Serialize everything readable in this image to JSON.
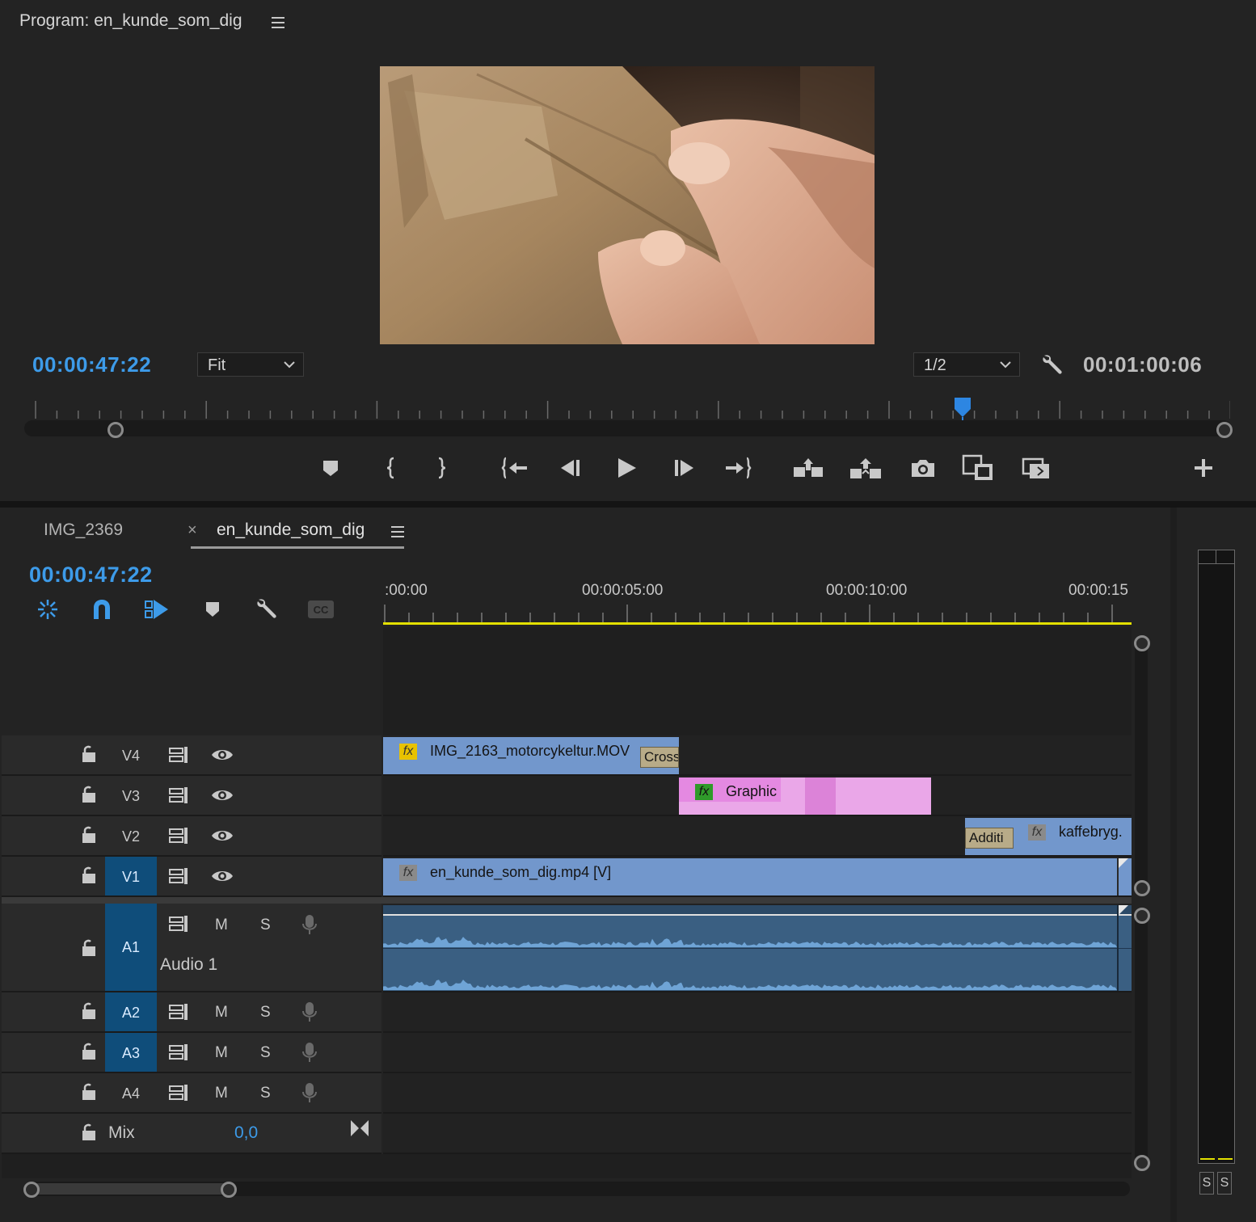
{
  "program": {
    "title": "Program: en_kunde_som_dig",
    "current_timecode": "00:00:47:22",
    "duration_timecode": "00:01:00:06",
    "zoom_select": "Fit",
    "resolution_select": "1/2",
    "playhead_fraction": 0.776
  },
  "transport": {
    "buttons": [
      "marker-icon",
      "mark-in-icon",
      "mark-out-icon",
      "go-to-in-icon",
      "step-back-icon",
      "play-icon",
      "step-forward-icon",
      "go-to-out-icon",
      "lift-icon",
      "extract-icon",
      "export-frame-icon",
      "comparison-view-icon",
      "proxy-toggle-icon",
      "add-button-icon"
    ]
  },
  "timeline": {
    "tabs": [
      {
        "label": "IMG_2369"
      },
      {
        "label": "en_kunde_som_dig",
        "active": true
      }
    ],
    "close_glyph": "×",
    "timecode": "00:00:47:22",
    "ruler_labels": [
      ":00:00",
      "00:00:05:00",
      "00:00:10:00",
      "00:00:15"
    ],
    "video_tracks": [
      {
        "name": "V4",
        "active": false
      },
      {
        "name": "V3",
        "active": false
      },
      {
        "name": "V2",
        "active": false
      },
      {
        "name": "V1",
        "active": true
      }
    ],
    "audio_tracks": [
      {
        "name": "A1",
        "label": "Audio 1",
        "m": "M",
        "s": "S"
      },
      {
        "name": "A2",
        "m": "M",
        "s": "S"
      },
      {
        "name": "A3",
        "m": "M",
        "s": "S"
      },
      {
        "name": "A4",
        "m": "M",
        "s": "S"
      }
    ],
    "mix": {
      "label": "Mix",
      "value": "0,0"
    },
    "clips": {
      "v4_clip": "IMG_2163_motorcykeltur.MOV",
      "v4_transition": "Cross",
      "v3_clip": "Graphic",
      "v2_transition": "Additi",
      "v2_clip": "kaffebryg.",
      "v1_clip": "en_kunde_som_dig.mp4 [V]",
      "fx_label": "fx"
    },
    "colors": {
      "video_clip": "#7297cc",
      "graphic_clip": "#eaa7e8",
      "audio_clip": "#3a5f82",
      "playhead_line": "#e3e000",
      "active_track": "#0f4d7a",
      "timecode_blue": "#3d9be9"
    }
  },
  "meter": {
    "solo_left": "S",
    "solo_right": "S"
  }
}
